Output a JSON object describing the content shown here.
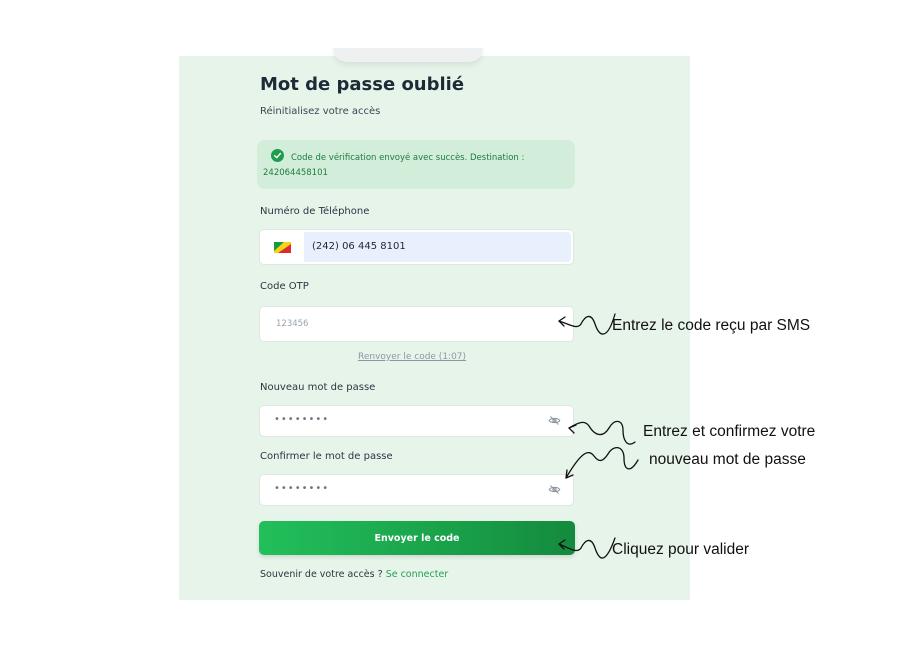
{
  "form": {
    "title": "Mot de passe oublié",
    "subtitle": "Réinitialisez votre accès",
    "alert": {
      "icon": "check-circle-icon",
      "message": "Code de vérification envoyé avec succès. Destination : 242064458101",
      "color": "#1f7a3d"
    },
    "phone": {
      "label": "Numéro de Téléphone",
      "flag": "congo-flag-icon",
      "value": "(242) 06 445 8101"
    },
    "otp": {
      "label": "Code OTP",
      "placeholder": "123456",
      "resend_label": "Renvoyer le code (1:07)"
    },
    "new_password": {
      "label": "Nouveau mot de passe",
      "masked_value": "••••••••",
      "toggle_icon": "eye-off-icon"
    },
    "confirm_password": {
      "label": "Confirmer le mot de passe",
      "masked_value": "••••••••",
      "toggle_icon": "eye-off-icon"
    },
    "submit_label": "Envoyer le code",
    "footer": {
      "prompt": "Souvenir de votre accès ? ",
      "link": "Se connecter"
    }
  },
  "annotations": {
    "otp": "Entrez le code reçu par SMS",
    "password_line1": "Entrez et confirmez votre",
    "password_line2": "nouveau mot de passe",
    "submit": "Cliquez pour valider"
  },
  "colors": {
    "accent": "#22a152",
    "panel_bg": "#e7f4ea",
    "button_start": "#22bf5b",
    "button_end": "#148a3d"
  }
}
